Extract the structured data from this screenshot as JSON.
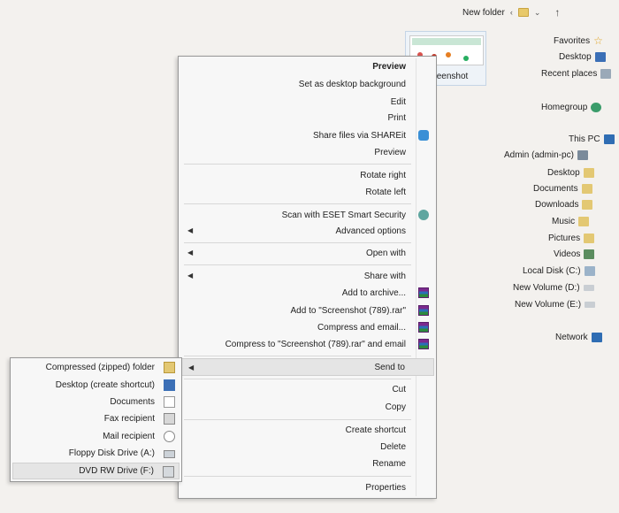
{
  "breadcrumb": {
    "folder": "New folder",
    "up": "↑"
  },
  "thumbnail": {
    "label": "Screenshot"
  },
  "nav": {
    "favorites": "Favorites",
    "desktop": "Desktop",
    "recent": "Recent places",
    "homegroup": "Homegroup",
    "thispc": "This PC",
    "items": [
      "Admin (admin-pc)",
      "Desktop",
      "Documents",
      "Downloads",
      "Music",
      "Pictures",
      "Videos",
      "Local Disk (C:)",
      "New Volume (D:)",
      "New Volume (E:)"
    ],
    "network": "Network"
  },
  "menu": {
    "preview_bold": "Preview",
    "set_bg": "Set as desktop background",
    "edit": "Edit",
    "print": "Print",
    "shareit": "Share files via SHAREit",
    "preview": "Preview",
    "rotate_right": "Rotate right",
    "rotate_left": "Rotate left",
    "eset": "Scan with ESET Smart Security",
    "advanced": "Advanced options",
    "open_with": "Open with",
    "share_with": "Share with",
    "add_archive": "Add to archive...",
    "add_rar": "Add to \"Screenshot (789).rar\"",
    "compress_email": "Compress and email...",
    "compress_rar_email": "Compress to \"Screenshot (789).rar\" and email",
    "send_to": "Send to",
    "cut": "Cut",
    "copy": "Copy",
    "create_shortcut": "Create shortcut",
    "delete": "Delete",
    "rename": "Rename",
    "properties": "Properties"
  },
  "submenu": {
    "compressed": "Compressed (zipped) folder",
    "desktop": "Desktop (create shortcut)",
    "documents": "Documents",
    "fax": "Fax recipient",
    "mail": "Mail recipient",
    "floppy": "Floppy Disk Drive (A:)",
    "dvd": "DVD RW Drive (F:)"
  },
  "colors": {
    "highlight": "#e5e5e5",
    "menu_bg": "#f7f7f7",
    "page_bg": "#f3f1ee"
  }
}
